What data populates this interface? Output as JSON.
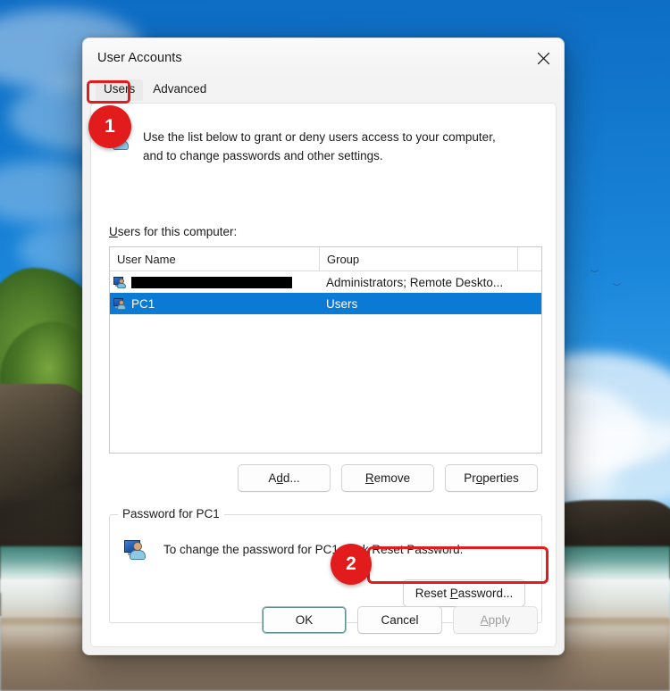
{
  "window": {
    "title": "User Accounts",
    "close_icon": "close-icon"
  },
  "tabs": [
    {
      "label": "Users",
      "selected": true
    },
    {
      "label": "Advanced",
      "selected": false
    }
  ],
  "intro": {
    "line1": "Use the list below to grant or deny users access to your computer,",
    "line2": "and to change passwords and other settings.",
    "icon": "user-account-icon"
  },
  "list": {
    "label_accesskey": "U",
    "label_rest": "sers for this computer:",
    "columns": [
      "User Name",
      "Group"
    ],
    "rows": [
      {
        "name": "",
        "redacted": true,
        "group": "Administrators; Remote Deskto...",
        "selected": false,
        "icon": "user-account-icon"
      },
      {
        "name": "PC1",
        "redacted": false,
        "group": "Users",
        "selected": true,
        "icon": "user-account-icon"
      }
    ]
  },
  "list_buttons": [
    {
      "label": "Add...",
      "name": "add-button"
    },
    {
      "label": "Remove",
      "name": "remove-button"
    },
    {
      "label": "Properties",
      "name": "properties-button"
    }
  ],
  "password_group": {
    "title": "Password for PC1",
    "description": "To change the password for PC1, click Reset Password.",
    "icon": "user-account-icon",
    "reset_button": "Reset Password..."
  },
  "footer_buttons": [
    {
      "label": "OK",
      "state": "default"
    },
    {
      "label": "Cancel",
      "state": "normal"
    },
    {
      "label": "Apply",
      "state": "disabled"
    }
  ],
  "annotations": {
    "badge1": "1",
    "badge2": "2",
    "color": "#e21c1c"
  },
  "colors": {
    "selection": "#0a7ad4",
    "dialog_bg": "#f3f3f3",
    "page_bg": "#ffffff",
    "annotation_red": "#e21c1c"
  }
}
